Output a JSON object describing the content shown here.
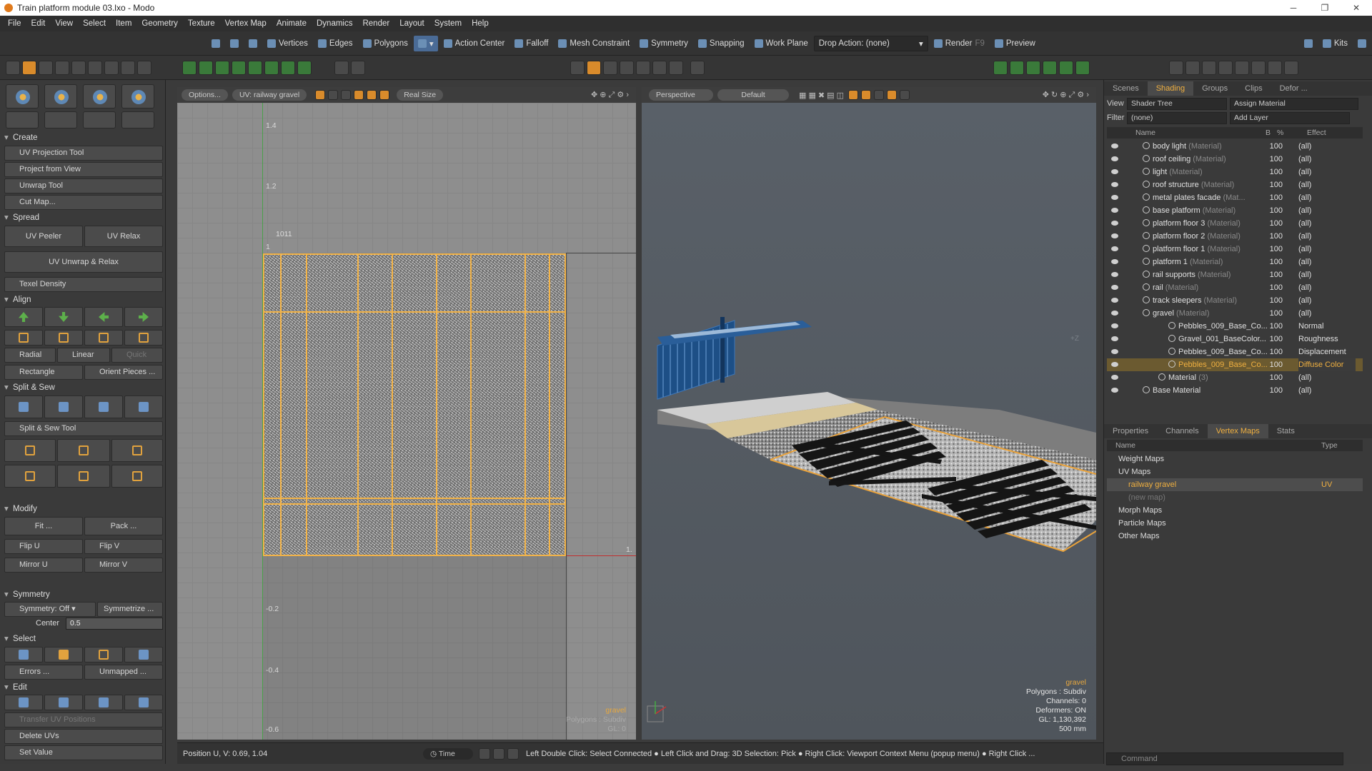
{
  "window": {
    "title": "Train platform module 03.lxo - Modo"
  },
  "menu": [
    "File",
    "Edit",
    "View",
    "Select",
    "Item",
    "Geometry",
    "Texture",
    "Vertex Map",
    "Animate",
    "Dynamics",
    "Render",
    "Layout",
    "System",
    "Help"
  ],
  "toolbar": {
    "vertices": "Vertices",
    "edges": "Edges",
    "polygons": "Polygons",
    "action_center": "Action Center",
    "falloff": "Falloff",
    "mesh_constraint": "Mesh Constraint",
    "symmetry": "Symmetry",
    "snapping": "Snapping",
    "work_plane": "Work Plane",
    "drop_action": "Drop Action: (none)",
    "render": "Render",
    "render_key": "F9",
    "preview": "Preview",
    "kits": "Kits"
  },
  "left": {
    "create": "Create",
    "uv_projection": "UV Projection Tool",
    "project_view": "Project from View",
    "unwrap": "Unwrap Tool",
    "cut_map": "Cut Map...",
    "spread": "Spread",
    "uv_peeler": "UV Peeler",
    "uv_relax": "UV Relax",
    "unwrap_relax": "UV Unwrap & Relax",
    "texel": "Texel Density",
    "align": "Align",
    "radial": "Radial",
    "linear": "Linear",
    "quick": "Quick",
    "rectangle": "Rectangle",
    "orient": "Orient Pieces ...",
    "split_sew": "Split & Sew",
    "split_sew_tool": "Split & Sew Tool",
    "modify": "Modify",
    "fit": "Fit ...",
    "pack": "Pack ...",
    "flip_u": "Flip U",
    "flip_v": "Flip V",
    "mirror_u": "Mirror U",
    "mirror_v": "Mirror V",
    "symmetry": "Symmetry",
    "symmetry_off": "Symmetry: Off",
    "symmetrize": "Symmetrize ...",
    "center_label": "Center",
    "center_value": "0.5",
    "select": "Select",
    "errors": "Errors ...",
    "unmapped": "Unmapped ...",
    "edit": "Edit",
    "transfer": "Transfer UV Positions",
    "delete_uvs": "Delete UVs",
    "set_value": "Set Value"
  },
  "uv": {
    "options": "Options...",
    "map": "UV: railway gravel",
    "real_size": "Real Size",
    "y_ticks": [
      "1.4",
      "1.2",
      "1",
      "-0.2",
      "-0.4",
      "-0.6"
    ],
    "tile": "1011",
    "x_tick_right": "1.",
    "info_name": "gravel",
    "info_poly": "Polygons : Subdiv",
    "info_gl": "GL: 0",
    "position": "Position U, V:  0.69, 1.04"
  },
  "persp": {
    "view": "Perspective",
    "shading": "Default",
    "axis": "+Z",
    "info_name": "gravel",
    "info_poly": "Polygons : Subdiv",
    "info_channels": "Channels: 0",
    "info_deformers": "Deformers: ON",
    "info_gl": "GL: 1,130,392",
    "info_size": "500 mm"
  },
  "right": {
    "tabs": [
      "Scenes",
      "Shading",
      "Groups",
      "Clips",
      "Defor ..."
    ],
    "view_label": "View",
    "view_value": "Shader Tree",
    "assign": "Assign Material",
    "filter_label": "Filter",
    "filter_value": "(none)",
    "add_layer": "Add Layer",
    "cols": {
      "name": "Name",
      "b": "B",
      "pct": "%",
      "effect": "Effect"
    },
    "items": [
      {
        "name": "body light",
        "type": "(Material)",
        "pct": "100",
        "effect": "(all)"
      },
      {
        "name": "roof ceiling",
        "type": "(Material)",
        "pct": "100",
        "effect": "(all)"
      },
      {
        "name": "light",
        "type": "(Material)",
        "pct": "100",
        "effect": "(all)"
      },
      {
        "name": "roof structure",
        "type": "(Material)",
        "pct": "100",
        "effect": "(all)"
      },
      {
        "name": "metal plates facade",
        "type": "(Mat...",
        "pct": "100",
        "effect": "(all)"
      },
      {
        "name": "base platform",
        "type": "(Material)",
        "pct": "100",
        "effect": "(all)"
      },
      {
        "name": "platform floor 3",
        "type": "(Material)",
        "pct": "100",
        "effect": "(all)"
      },
      {
        "name": "platform floor 2",
        "type": "(Material)",
        "pct": "100",
        "effect": "(all)"
      },
      {
        "name": "platform floor 1",
        "type": "(Material)",
        "pct": "100",
        "effect": "(all)"
      },
      {
        "name": "platform 1",
        "type": "(Material)",
        "pct": "100",
        "effect": "(all)"
      },
      {
        "name": "rail supports",
        "type": "(Material)",
        "pct": "100",
        "effect": "(all)"
      },
      {
        "name": "rail",
        "type": "(Material)",
        "pct": "100",
        "effect": "(all)"
      },
      {
        "name": "track sleepers",
        "type": "(Material)",
        "pct": "100",
        "effect": "(all)"
      },
      {
        "name": "gravel",
        "type": "(Material)",
        "pct": "100",
        "effect": "(all)"
      },
      {
        "name": "Pebbles_009_Base_Co...",
        "type": "",
        "pct": "100",
        "effect": "Normal"
      },
      {
        "name": "Gravel_001_BaseColor...",
        "type": "",
        "pct": "100",
        "effect": "Roughness"
      },
      {
        "name": "Pebbles_009_Base_Co...",
        "type": "",
        "pct": "100",
        "effect": "Displacement"
      },
      {
        "name": "Pebbles_009_Base_Co...",
        "type": "",
        "pct": "100",
        "effect": "Diffuse Color"
      },
      {
        "name": "Material",
        "type": "(3)",
        "pct": "100",
        "effect": "(all)"
      },
      {
        "name": "Base Material",
        "type": "",
        "pct": "100",
        "effect": "(all)"
      }
    ],
    "tabs2": [
      "Properties",
      "Channels",
      "Vertex Maps",
      "Stats"
    ],
    "vcols": {
      "name": "Name",
      "type": "Type"
    },
    "vmaps": [
      {
        "name": "Weight Maps",
        "type": ""
      },
      {
        "name": "UV Maps",
        "type": ""
      },
      {
        "name": "railway gravel",
        "type": "UV"
      },
      {
        "name": "(new map)",
        "type": ""
      },
      {
        "name": "Morph Maps",
        "type": ""
      },
      {
        "name": "Particle Maps",
        "type": ""
      },
      {
        "name": "Other Maps",
        "type": ""
      }
    ],
    "command": "Command"
  },
  "status": {
    "time": "Time",
    "hint": "Left Double Click: Select Connected ● Left Click and Drag: 3D Selection: Pick ● Right Click: Viewport Context Menu (popup menu) ● Right Click ..."
  }
}
